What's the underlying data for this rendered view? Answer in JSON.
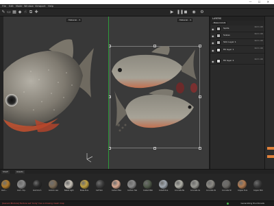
{
  "window": {
    "title": "",
    "controls": [
      "—",
      "☐",
      "✕"
    ]
  },
  "menubar": {
    "items": [
      "File",
      "Edit",
      "Mode",
      "Window",
      "Viewport",
      "Help"
    ]
  },
  "toolbar": {
    "icons": [
      "paint-brush-icon",
      "eraser-icon",
      "projection-icon",
      "polygon-fill-icon",
      "smudge-icon",
      "clone-icon",
      "color-picker-icon"
    ],
    "view_icons": [
      "play-icon",
      "pause-icon",
      "render-icon",
      "camera-icon",
      "settings-icon"
    ]
  },
  "viewport3d": {
    "channel_dropdown": "Material"
  },
  "viewport2d": {
    "channel_dropdown": "Material"
  },
  "layers": {
    "title": "LAYERS",
    "texture_set": "Base Color",
    "rows": [
      {
        "name": "Spots",
        "blend": "Norm\n100"
      },
      {
        "name": "Scales",
        "blend": "Norm\n100"
      },
      {
        "name": "Skin Layer 1",
        "blend": "Norm\n100"
      },
      {
        "name": "Fill layer 1",
        "blend": "Norm\n100"
      },
      {
        "name": "Fill layer 2",
        "blend": "Norm\n100"
      }
    ]
  },
  "shelf": {
    "tabs": [
      "Shelf",
      "Assets"
    ],
    "materials": [
      {
        "label": "Alum...",
        "color": "#b07a2a"
      },
      {
        "label": "Alum. Imp.",
        "color": "#8a8a8a"
      },
      {
        "label": "Aluminium",
        "color": "#2a2a2a"
      },
      {
        "label": "Autumn Leaf",
        "color": "#7a6a55"
      },
      {
        "label": "Baked Light",
        "color": "#c8c2b8"
      },
      {
        "label": "Brass Pure",
        "color": "#c0a040"
      },
      {
        "label": "Calf Skin",
        "color": "#3c3c3c"
      },
      {
        "label": "Carbon Fiber",
        "color": "#d8a890"
      },
      {
        "label": "Cartoon Hair",
        "color": "#8a8a8a"
      },
      {
        "label": "Coated Metal",
        "color": "#505a4a"
      },
      {
        "label": "Cobalt Pure",
        "color": "#a0a8b0"
      },
      {
        "label": "Concrete Bare",
        "color": "#b0b0a8"
      },
      {
        "label": "Concrete Cast",
        "color": "#9a9a94"
      },
      {
        "label": "Concrete Dirty",
        "color": "#8c8a84"
      },
      {
        "label": "Concrete Simple",
        "color": "#6a6864"
      },
      {
        "label": "Copper Pure",
        "color": "#b07a50"
      },
      {
        "label": "Copper Worn",
        "color": "#3a3a3a"
      }
    ]
  },
  "status": {
    "message": "[GenericModule] Texture set 'body' has a missing mesh map",
    "right": "Generating thumbnails"
  }
}
